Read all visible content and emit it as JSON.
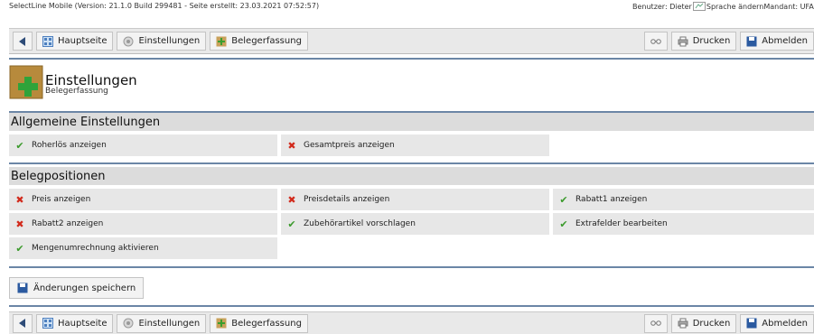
{
  "topbar": {
    "info": "SelectLine Mobile (Version: 21.1.0 Build 299481 - Seite erstellt: 23.03.2021 07:52:57)",
    "user": "Benutzer: Dieter",
    "language": "Sprache ändern",
    "client": "Mandant: UFAKT"
  },
  "toolbar": {
    "home": "Hauptseite",
    "settings": "Einstellungen",
    "capture": "Belegerfassung",
    "print": "Drucken",
    "logout": "Abmelden"
  },
  "header": {
    "title": "Einstellungen",
    "subtitle": "Belegerfassung"
  },
  "sections": {
    "general": {
      "title": "Allgemeine Einstellungen",
      "items": [
        {
          "label": "Roherlös anzeigen",
          "checked": true
        },
        {
          "label": "Gesamtpreis anzeigen",
          "checked": false
        }
      ]
    },
    "positions": {
      "title": "Belegpositionen",
      "items": [
        {
          "label": "Preis anzeigen",
          "checked": false
        },
        {
          "label": "Preisdetails anzeigen",
          "checked": false
        },
        {
          "label": "Rabatt1 anzeigen",
          "checked": true
        },
        {
          "label": "Rabatt2 anzeigen",
          "checked": false
        },
        {
          "label": "Zubehörartikel vorschlagen",
          "checked": true
        },
        {
          "label": "Extrafelder bearbeiten",
          "checked": true
        },
        {
          "label": "Mengenumrechnung aktivieren",
          "checked": true
        }
      ]
    }
  },
  "save": {
    "label": "Änderungen speichern"
  },
  "colors": {
    "ok": "#3b9a2c",
    "no": "#d22a1c",
    "separator": "#6b86a6"
  }
}
